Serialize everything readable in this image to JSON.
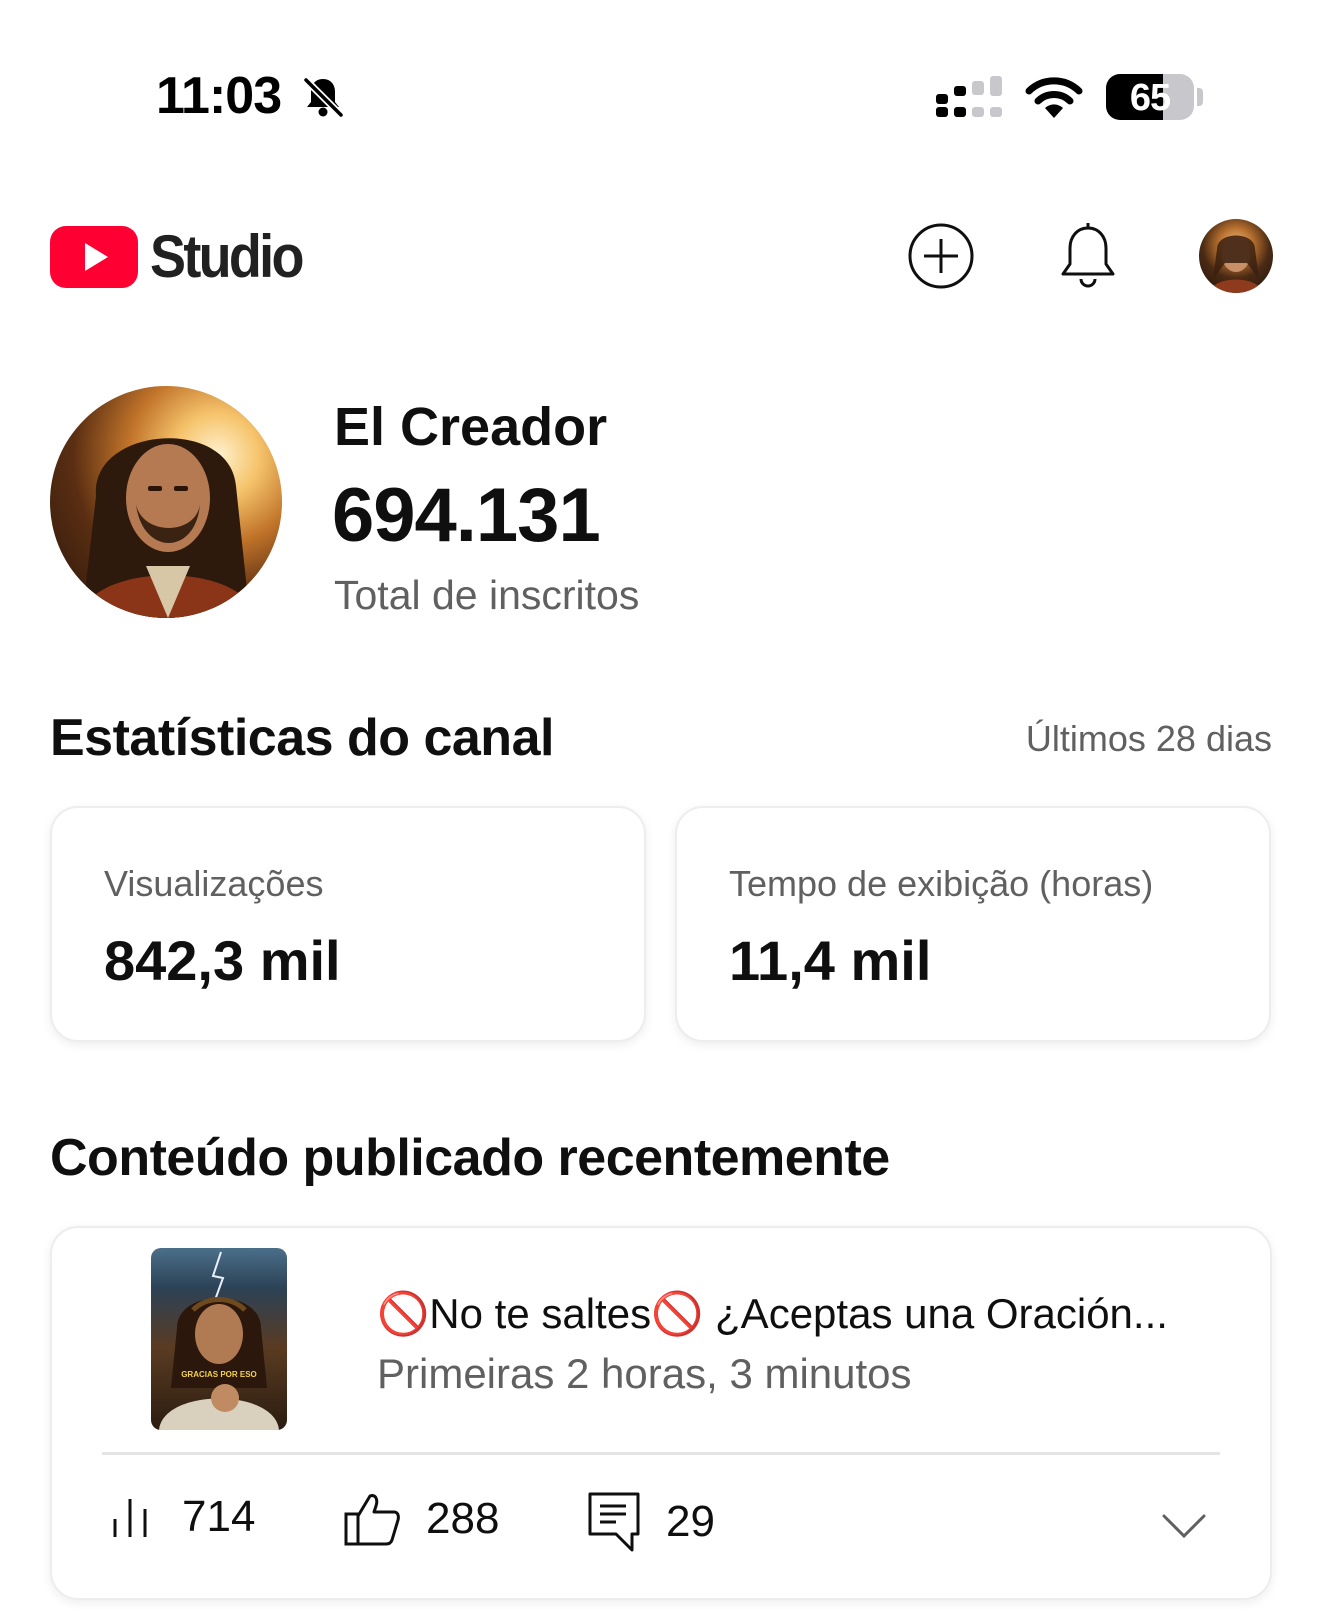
{
  "status_bar": {
    "time": "11:03",
    "battery": "65",
    "battery_level": 0.65
  },
  "header": {
    "app_name": "Studio",
    "brand_color": "#ff0033"
  },
  "channel": {
    "name": "El Creador",
    "subscribers": "694.131",
    "subscribers_label": "Total de inscritos"
  },
  "stats": {
    "title": "Estatísticas do canal",
    "period": "Últimos 28 dias",
    "cards": [
      {
        "label": "Visualizações",
        "value": "842,3 mil"
      },
      {
        "label": "Tempo de exibição (horas)",
        "value": "11,4 mil"
      }
    ]
  },
  "recent": {
    "title": "Conteúdo publicado recentemente",
    "video": {
      "title": "🚫No te saltes🚫 ¿Aceptas una Oración...",
      "meta": "Primeiras 2 horas, 3 minutos",
      "thumbnail_caption": "GRACIAS POR ESO",
      "views": "714",
      "likes": "288",
      "comments": "29"
    }
  },
  "icons": [
    "bell-slash-icon",
    "signal-icon",
    "wifi-icon",
    "battery-icon",
    "youtube-logo-icon",
    "create-icon",
    "bell-icon",
    "bar-chart-icon",
    "thumbs-up-icon",
    "comment-icon",
    "chevron-down-icon"
  ]
}
